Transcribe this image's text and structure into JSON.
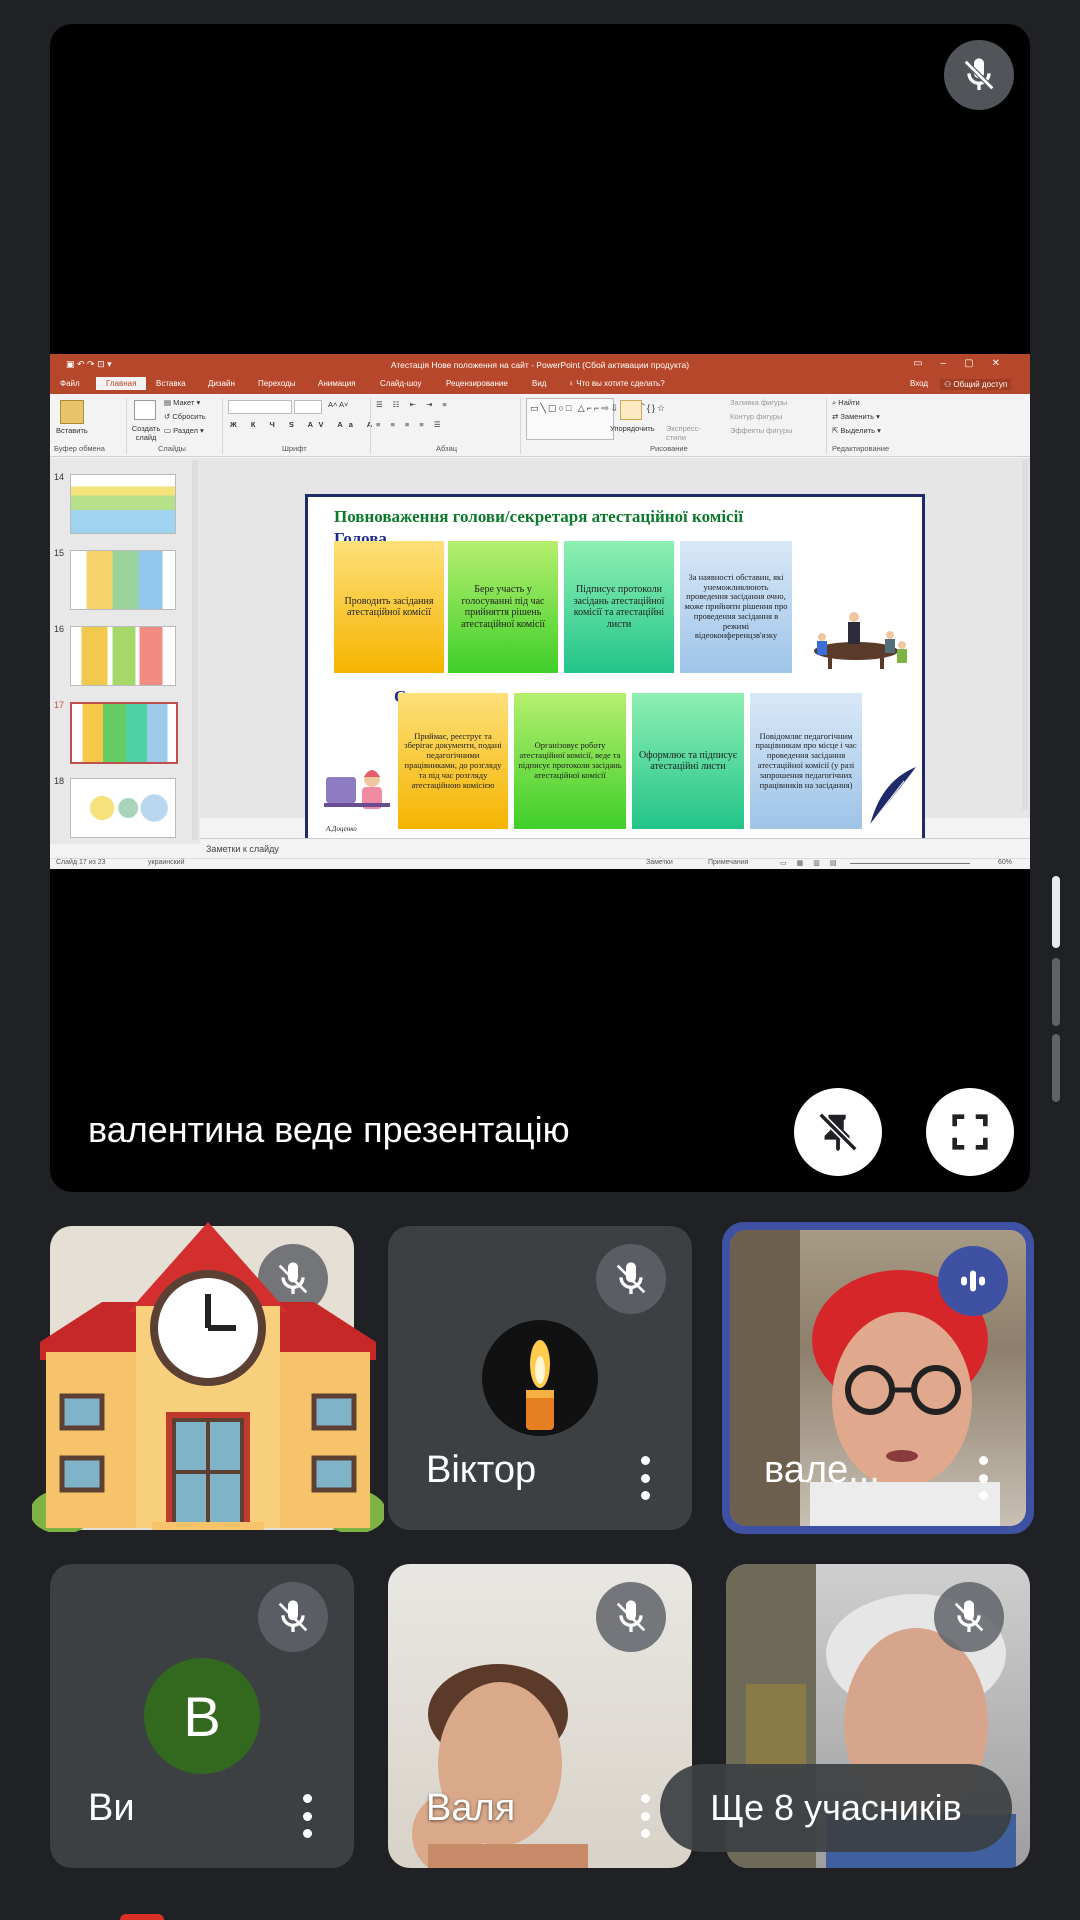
{
  "presentation": {
    "presenter_label": "валентина веде презентацію",
    "slide_window": {
      "title": "Атестація Нове положення на сайт - PowerPoint (Сбой активации продукта)",
      "tabs": [
        "Файл",
        "Главная",
        "Вставка",
        "Дизайн",
        "Переходы",
        "Анимация",
        "Слайд-шоу",
        "Рецензирование",
        "Вид"
      ],
      "active_tab": "Главная",
      "tell_me": "Что вы хотите сделать?",
      "signin": "Вход",
      "share": "Общий доступ",
      "ribbon": {
        "paste": "Вставить",
        "new_slide": "Создать слайд",
        "layout": "Макет",
        "reset": "Сбросить",
        "section": "Раздел",
        "arrange": "Упорядочить",
        "quick_styles": "Экспресс-стили",
        "fill": "Заливка фигуры",
        "outline": "Контур фигуры",
        "effects": "Эффекты фигуры",
        "find": "Найти",
        "replace": "Заменить",
        "select": "Выделить",
        "groups": [
          "Буфер обмена",
          "Слайды",
          "Шрифт",
          "Абзац",
          "Рисование",
          "Редактирование"
        ]
      },
      "thumbnails": [
        "14",
        "15",
        "16",
        "17",
        "18"
      ],
      "selected_thumbnail": "17",
      "notes_placeholder": "Заметки к слайду",
      "status": {
        "slide_count": "Слайд 17 из 23",
        "language": "украинский",
        "notes": "Заметки",
        "comments": "Примечания",
        "zoom": "60%"
      },
      "slide": {
        "title": "Повноваження голови/секретаря атестаційної комісії",
        "section1": "Голова",
        "section2": "Секретар",
        "head_cards": [
          "Проводить засідання атестаційної комісії",
          "Бере участь у голосуванні під час прийняття рішень атестаційної комісії",
          "Підписує протоколи засідань атестаційної комісії та атестаційні листи",
          "За наявності обставин, які унеможливлюють проведення засідання очно, може прийняти рішення про проведення засідання в режимі відеоконференцзв'язку"
        ],
        "secretary_cards": [
          "Приймає, реєструє та зберігає документи, подані педагогічними працівниками, до розгляду та під час розгляду атестаційною комісією",
          "Організовує роботу атестаційної комісії, веде та підписує протоколи засідань атестаційної комісії",
          "Оформлює та підписує атестаційні листи",
          "Повідомляє педагогічним працівникам про місце і час проведення засідання атестаційної комісії (у разі запрошення педагогічних працівників на засідання)"
        ],
        "signature": "А.Доценко"
      }
    }
  },
  "participants": [
    {
      "name": "",
      "muted": true,
      "avatar": "school-building-emoji"
    },
    {
      "name": "Віктор",
      "muted": true,
      "avatar": "candle-image"
    },
    {
      "name": "вале...",
      "muted": false,
      "speaking": true,
      "avatar": "camera-video"
    },
    {
      "name": "Ви",
      "muted": true,
      "avatar_letter": "В",
      "avatar_color": "#33691e"
    },
    {
      "name": "Валя",
      "muted": true,
      "avatar": "camera-video"
    },
    {
      "name": "",
      "muted": true,
      "avatar": "camera-video"
    }
  ],
  "more_participants": "Ще 8 учасників",
  "colors": {
    "background": "#202124",
    "tile": "#3c4043",
    "speaking_border": "#3f51a3",
    "ppt_red": "#b7472a"
  }
}
